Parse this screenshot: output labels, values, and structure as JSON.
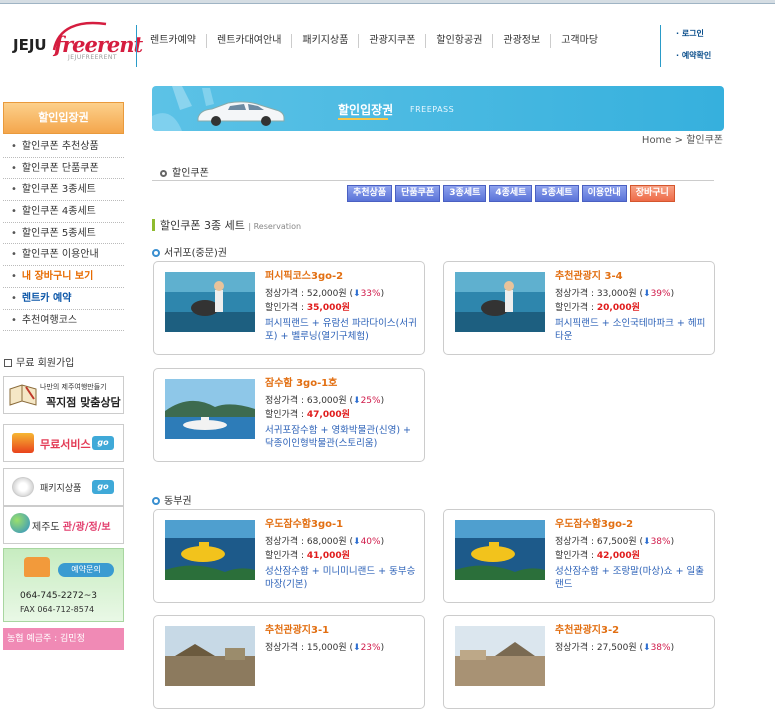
{
  "logo": {
    "jeju": "JEJU",
    "free": "freerent",
    "sub": "JEJUFREERENT"
  },
  "nav": [
    "렌트카예약",
    "렌트카대여안내",
    "패키지상품",
    "관광지쿠폰",
    "할인항공권",
    "관광정보",
    "고객마당"
  ],
  "toplinks": [
    "· 로그인",
    "· 예약확인"
  ],
  "sidebar": {
    "header": "할인입장권",
    "items": [
      {
        "label": "할인쿠폰 추천상품",
        "style": "normal"
      },
      {
        "label": "할인쿠폰 단품쿠폰",
        "style": "normal"
      },
      {
        "label": "할인쿠폰 3종세트",
        "style": "normal"
      },
      {
        "label": "할인쿠폰 4종세트",
        "style": "normal"
      },
      {
        "label": "할인쿠폰 5종세트",
        "style": "normal"
      },
      {
        "label": "할인쿠폰 이용안내",
        "style": "normal"
      },
      {
        "label": "내 장바구니 보기",
        "style": "orange"
      },
      {
        "label": "렌트카 예약",
        "style": "blue"
      },
      {
        "label": "추천여행코스",
        "style": "normal"
      }
    ],
    "member_join": "무료 회원가입",
    "box1_line1": "나만의 제주여행만들기",
    "box1_line2": "꼭지점 맞춤상담",
    "box2_label": "무료서비스",
    "box3_label": "패키지상품",
    "box4_prefix": "제주도 ",
    "box4_label": "관/광/정/보",
    "go": "go",
    "call_title": "예약문의",
    "tel": "064-745-2272~3",
    "fax": "FAX 064-712-8574",
    "bank": "농협  예금주 : 김민정"
  },
  "banner": {
    "title": "할인입장권",
    "subtitle": "FREEPASS"
  },
  "breadcrumb": "Home > 할인쿠폰",
  "section_title": "할인쿠폰",
  "tabs": [
    "추천상품",
    "단품쿠폰",
    "3종세트",
    "4종세트",
    "5종세트",
    "이용안내",
    "장바구니"
  ],
  "page_title": "할인쿠폰 3종 세트",
  "page_title_sub": "| Reservation",
  "regions": [
    "서귀포(중문)권",
    "동부권"
  ],
  "labels": {
    "regular": "정상가격 : ",
    "discount": "할인가격 : "
  },
  "products": [
    {
      "name": "퍼시픽코스3go-2",
      "regular": "52,000원",
      "pct": "33%",
      "discount": "35,000원",
      "desc": "퍼시픽랜드 + 유람선 파라다이스(서귀포) + 벨루닝(열기구체험)"
    },
    {
      "name": "추천관광지 3-4",
      "regular": "33,000원",
      "pct": "39%",
      "discount": "20,000원",
      "desc": "퍼시픽랜드 + 소인국테마파크 + 헤피타운"
    },
    {
      "name": "잠수함 3go-1호",
      "regular": "63,000원",
      "pct": "25%",
      "discount": "47,000원",
      "desc": "서귀포잠수함 + 영화박물관(신영) + 닥종이인형박물관(스토리움)"
    },
    {
      "name": "우도잠수함3go-1",
      "regular": "68,000원",
      "pct": "40%",
      "discount": "41,000원",
      "desc": "성산잠수함 + 미니미니랜드 + 동부승마장(기본)"
    },
    {
      "name": "우도잠수함3go-2",
      "regular": "67,500원",
      "pct": "38%",
      "discount": "42,000원",
      "desc": "성산잠수함 + 조랑말(마상)쇼 + 일출랜드"
    },
    {
      "name": "추천관광지3-1",
      "regular": "15,000원",
      "pct": "23%",
      "discount": "",
      "desc": ""
    },
    {
      "name": "추천관광지3-2",
      "regular": "27,500원",
      "pct": "38%",
      "discount": "",
      "desc": ""
    }
  ]
}
